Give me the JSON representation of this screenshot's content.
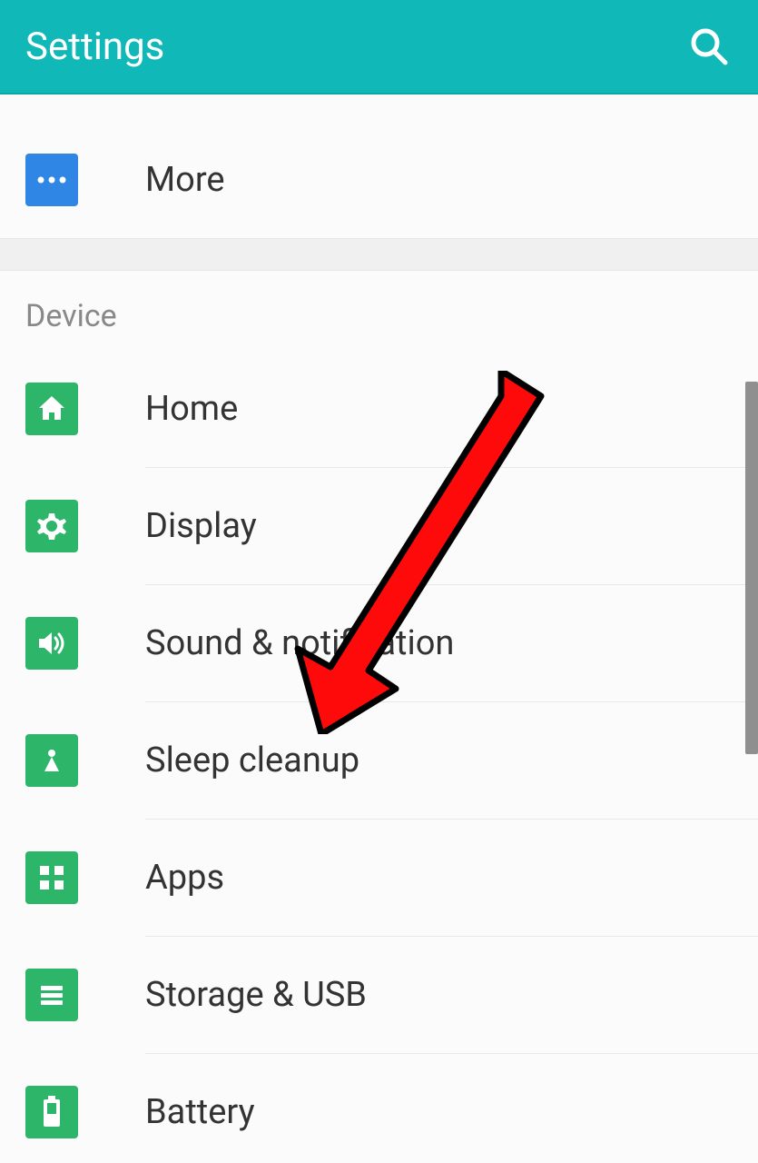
{
  "header": {
    "title": "Settings"
  },
  "top": {
    "more": {
      "label": "More",
      "icon": "more"
    }
  },
  "device": {
    "header": "Device",
    "items": [
      {
        "label": "Home",
        "icon": "home",
        "key": "home"
      },
      {
        "label": "Display",
        "icon": "gear",
        "key": "display"
      },
      {
        "label": "Sound & notification",
        "icon": "sound",
        "key": "sound"
      },
      {
        "label": "Sleep cleanup",
        "icon": "clean",
        "key": "sleep"
      },
      {
        "label": "Apps",
        "icon": "apps",
        "key": "apps"
      },
      {
        "label": "Storage & USB",
        "icon": "storage",
        "key": "storage"
      },
      {
        "label": "Battery",
        "icon": "battery",
        "key": "battery"
      }
    ]
  },
  "annotation": {
    "arrow_target": "sound"
  }
}
